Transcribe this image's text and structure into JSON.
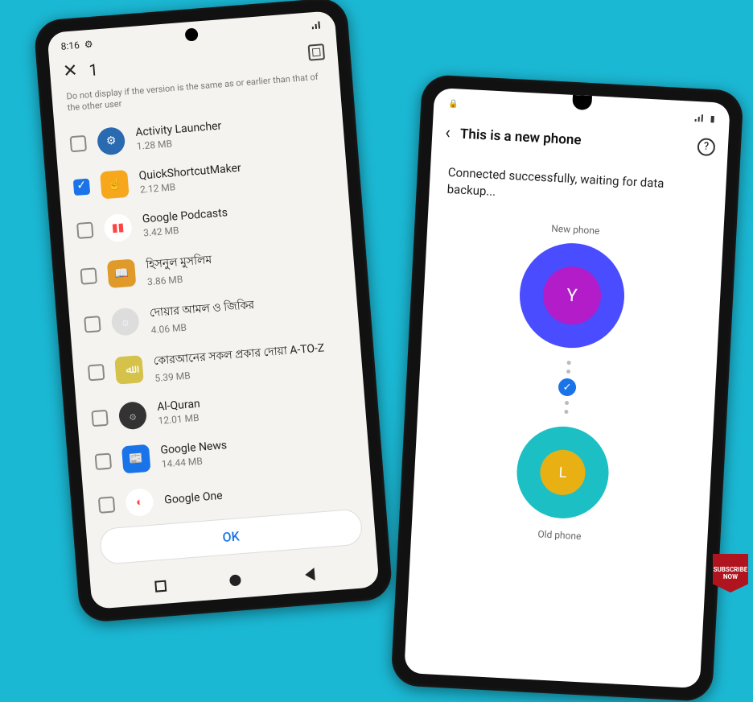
{
  "left": {
    "status": {
      "time": "8:16",
      "gear": "⚙"
    },
    "header": {
      "count": "1"
    },
    "hint": "Do not display if the version is the same as or earlier than that of the other user",
    "apps": [
      {
        "name": "Activity Launcher",
        "size": "1.28 MB",
        "checked": false,
        "bg": "#2a6ab0",
        "shape": "circle",
        "glyph": "⚙"
      },
      {
        "name": "QuickShortcutMaker",
        "size": "2.12 MB",
        "checked": true,
        "bg": "#f7a71b",
        "shape": "square",
        "glyph": "☝"
      },
      {
        "name": "Google Podcasts",
        "size": "3.42 MB",
        "checked": false,
        "bg": "#fff",
        "shape": "circle",
        "glyph": "▮▮"
      },
      {
        "name": "হিসনুল মুসলিম",
        "size": "3.86 MB",
        "checked": false,
        "bg": "#e09a2a",
        "shape": "square",
        "glyph": "📖"
      },
      {
        "name": "দোয়ার আমল ও জিকির",
        "size": "4.06 MB",
        "checked": false,
        "bg": "#ddd",
        "shape": "circle",
        "glyph": "۞"
      },
      {
        "name": "কোরআনের সকল প্রকার দোয়া A-TO-Z",
        "size": "5.39 MB",
        "checked": false,
        "bg": "#d4c24a",
        "shape": "square",
        "glyph": "ﷲ"
      },
      {
        "name": "Al-Quran",
        "size": "12.01 MB",
        "checked": false,
        "bg": "#333",
        "shape": "circle",
        "glyph": "۞"
      },
      {
        "name": "Google News",
        "size": "14.44 MB",
        "checked": false,
        "bg": "#1a73e8",
        "shape": "square",
        "glyph": "📰"
      },
      {
        "name": "Google One",
        "size": "",
        "checked": false,
        "bg": "#fff",
        "shape": "circle",
        "glyph": "◐"
      }
    ],
    "ok_label": "OK"
  },
  "right": {
    "header": {
      "title": "This is a new phone"
    },
    "status_msg": "Connected successfully, waiting for data backup...",
    "new_label": "New phone",
    "new_letter": "Y",
    "old_label": "Old phone",
    "old_letter": "L"
  },
  "badge": {
    "line1": "SUBSCRIBE",
    "line2": "NOW"
  }
}
